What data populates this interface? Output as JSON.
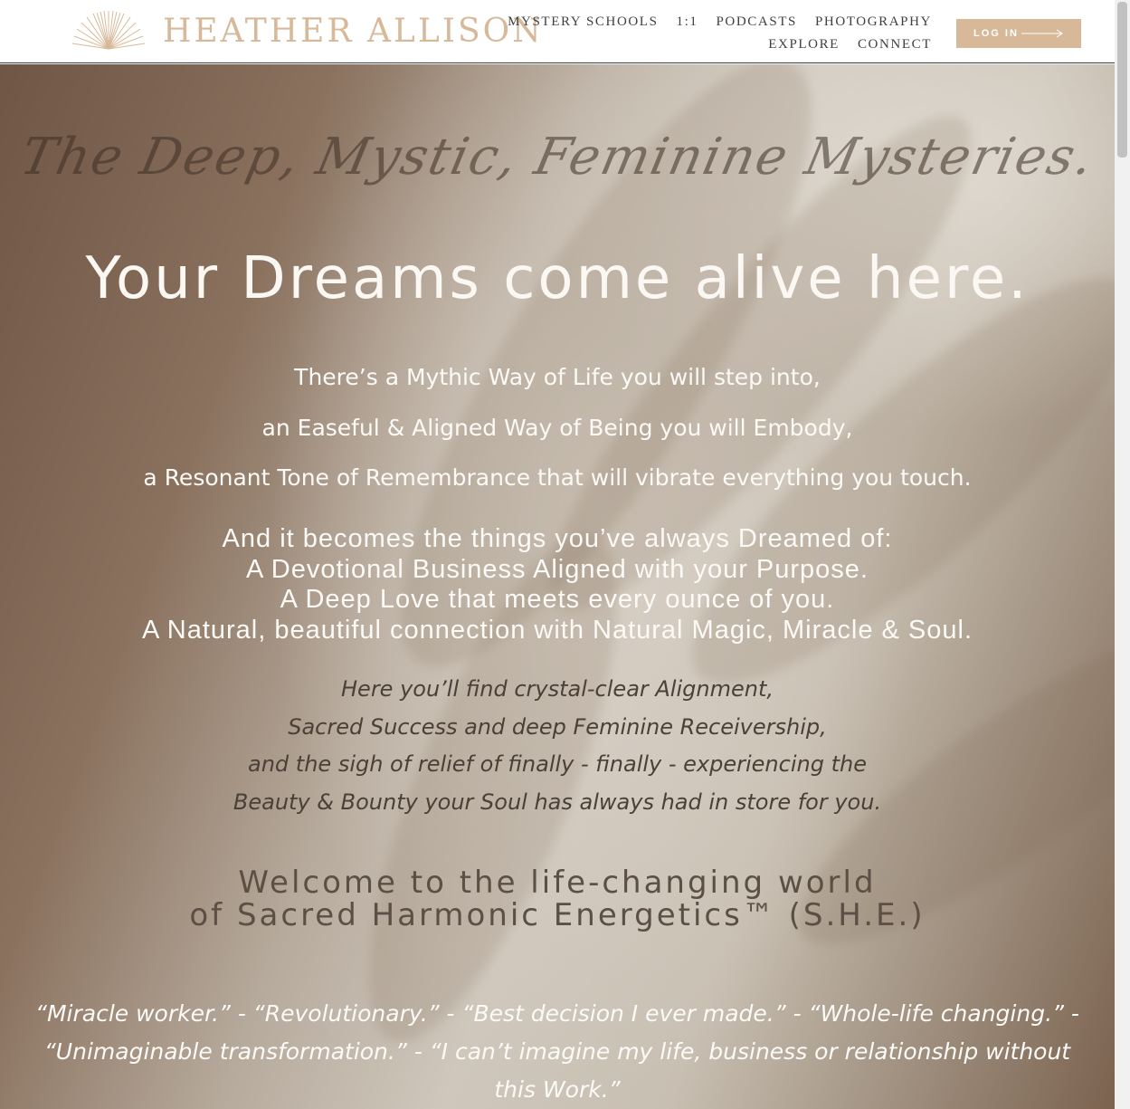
{
  "header": {
    "logo_text": "HEATHER ALLISON",
    "nav_row1": [
      "MYSTERY SCHOOLS",
      "1:1",
      "PODCASTS",
      "PHOTOGRAPHY"
    ],
    "nav_row2": [
      "EXPLORE",
      "CONNECT"
    ],
    "login_label": "LOG IN"
  },
  "hero": {
    "script_tagline": "The Deep, Mystic, Feminine Mysteries.",
    "headline": "Your Dreams come alive here.",
    "intro_lines": [
      "There’s a Mythic Way of Life you will step into,",
      "an Easeful & Aligned Way of Being you will Embody,",
      "a Resonant Tone of Remembrance that will vibrate everything you touch."
    ],
    "dream_lines": [
      "And it becomes the things you’ve always Dreamed of:",
      "A Devotional Business Aligned with your Purpose.",
      "A Deep Love that meets every ounce of you.",
      "A Natural, beautiful connection with Natural Magic, Miracle & Soul."
    ],
    "find_lines": [
      "Here you’ll find crystal-clear Alignment,",
      "Sacred Success and deep Feminine Receivership,",
      "and the sigh of relief of finally - finally - experiencing the",
      "Beauty & Bounty your Soul has always had in store for you."
    ],
    "welcome_lines": [
      "Welcome to  the life-changing world",
      "of Sacred Harmonic Energetics™ (S.H.E.)"
    ],
    "testimonial_lines": [
      "“Miracle worker.” - “Revolutionary.” - “Best decision I ever made.” - “Whole-life changing.” -",
      "“Unimaginable transformation.” - “I can’t imagine my life, business or relationship without",
      "this Work.”"
    ]
  },
  "colors": {
    "accent": "#d7b99a",
    "headline": "#fbf8f3",
    "nav_text": "#3f3f3f"
  }
}
